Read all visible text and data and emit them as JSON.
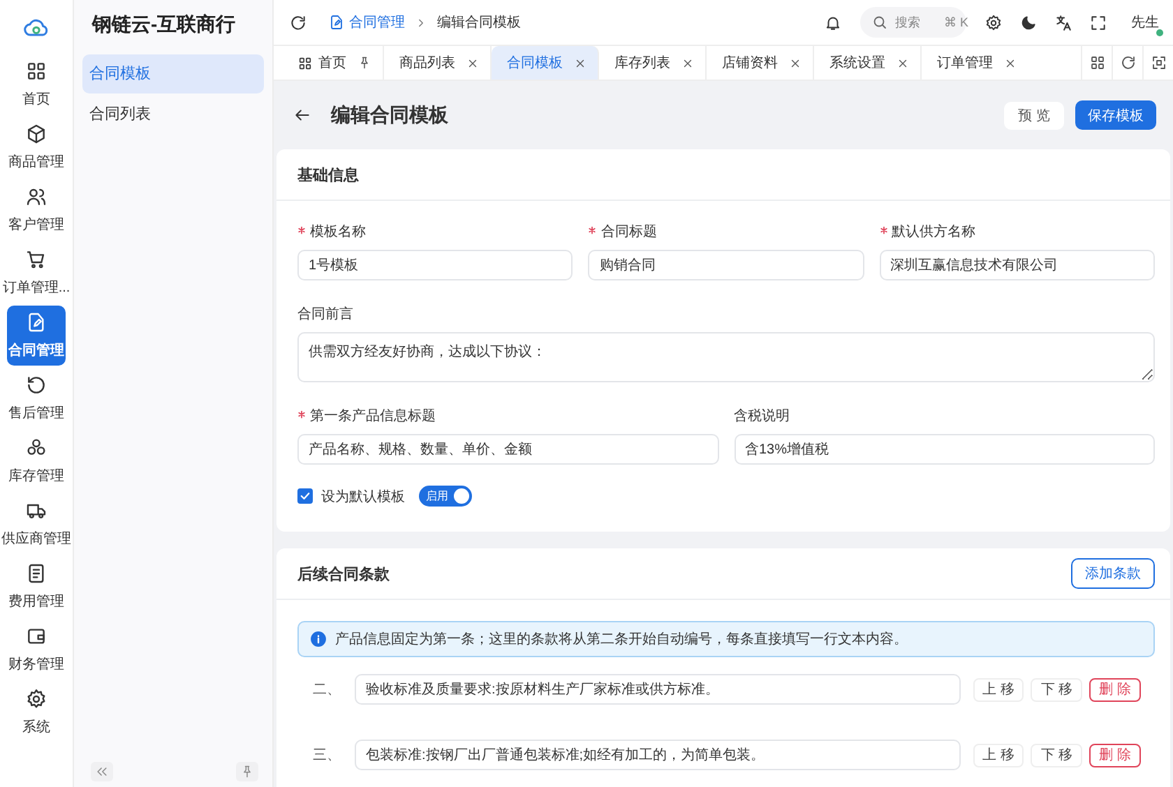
{
  "app": {
    "title": "钢链云-互联商行"
  },
  "rail": [
    {
      "label": "首页",
      "selected": false
    },
    {
      "label": "商品管理",
      "selected": false
    },
    {
      "label": "客户管理",
      "selected": false
    },
    {
      "label": "订单管理...",
      "selected": false
    },
    {
      "label": "合同管理",
      "selected": true
    },
    {
      "label": "售后管理",
      "selected": false
    },
    {
      "label": "库存管理",
      "selected": false
    },
    {
      "label": "供应商管理",
      "selected": false
    },
    {
      "label": "费用管理",
      "selected": false
    },
    {
      "label": "财务管理",
      "selected": false
    },
    {
      "label": "系统",
      "selected": false
    }
  ],
  "submenu": [
    {
      "label": "合同模板",
      "selected": true
    },
    {
      "label": "合同列表",
      "selected": false
    }
  ],
  "header": {
    "breadcrumb": [
      "合同管理",
      "编辑合同模板"
    ],
    "search": {
      "placeholder": "搜索",
      "shortcut": "⌘ K"
    },
    "user": "先生"
  },
  "tabs": [
    {
      "label": "首页",
      "selected": false,
      "kind": "pinned"
    },
    {
      "label": "商品列表",
      "selected": false,
      "kind": "closable"
    },
    {
      "label": "合同模板",
      "selected": true,
      "kind": "closable"
    },
    {
      "label": "库存列表",
      "selected": false,
      "kind": "closable"
    },
    {
      "label": "店铺资料",
      "selected": false,
      "kind": "closable"
    },
    {
      "label": "系统设置",
      "selected": false,
      "kind": "closable"
    },
    {
      "label": "订单管理",
      "selected": false,
      "kind": "closable"
    }
  ],
  "page": {
    "title": "编辑合同模板",
    "buttons": [
      {
        "label": "预 览",
        "kind": "default"
      },
      {
        "label": "保存模板",
        "kind": "primary"
      }
    ]
  },
  "basic": {
    "title": "基础信息",
    "field_rows": [
      [
        {
          "label": "模板名称",
          "required": true,
          "value": "1号模板",
          "kind": "input"
        },
        {
          "label": "合同标题",
          "required": true,
          "value": "购销合同",
          "kind": "input"
        },
        {
          "label": "默认供方名称",
          "required": true,
          "value": "深圳互赢信息技术有限公司",
          "kind": "input"
        }
      ],
      [
        {
          "label": "合同前言",
          "required": false,
          "value": "供需双方经友好协商，达成以下协议：",
          "kind": "textarea"
        }
      ],
      [
        {
          "label": "第一条产品信息标题",
          "required": true,
          "value": "产品名称、规格、数量、单价、金额",
          "kind": "input"
        },
        {
          "label": "含税说明",
          "required": false,
          "value": "含13%增值税",
          "kind": "input"
        }
      ]
    ],
    "checkbox": {
      "label": "设为默认模板",
      "checked": true
    },
    "switch": {
      "label": "启用",
      "on": true
    }
  },
  "clauses": {
    "title": "后续合同条款",
    "add_button": "添加条款",
    "notice": "产品信息固定为第一条；这里的条款将从第二条开始自动编号，每条直接填写一行文本内容。",
    "items": [
      {
        "number": "二、",
        "value": "验收标准及质量要求:按原材料生产厂家标准或供方标准。",
        "buttons": [
          {
            "label": "上 移",
            "kind": "default"
          },
          {
            "label": "下 移",
            "kind": "default"
          },
          {
            "label": "删 除",
            "kind": "danger"
          }
        ]
      },
      {
        "number": "三、",
        "value": "包装标准:按钢厂出厂普通包装标准;如经有加工的，为简单包装。",
        "buttons": [
          {
            "label": "上 移",
            "kind": "default"
          },
          {
            "label": "下 移",
            "kind": "default"
          },
          {
            "label": "删 除",
            "kind": "danger"
          }
        ]
      }
    ]
  }
}
